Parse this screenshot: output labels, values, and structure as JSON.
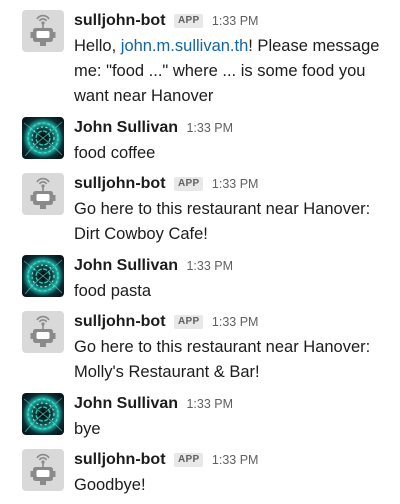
{
  "messages": [
    {
      "sender": "sulljohn-bot",
      "badge": "APP",
      "time": "1:33 PM",
      "text_before": "Hello, ",
      "link": "john.m.sullivan.th",
      "text_after": "! Please message me: \"food ...\" where ... is some food you want near Hanover",
      "avatar": "robot-icon"
    },
    {
      "sender": "John Sullivan",
      "time": "1:33 PM",
      "text": "food coffee",
      "avatar": "user-avatar"
    },
    {
      "sender": "sulljohn-bot",
      "badge": "APP",
      "time": "1:33 PM",
      "text": "Go here to this restaurant near Hanover: Dirt Cowboy Cafe!",
      "avatar": "robot-icon"
    },
    {
      "sender": "John Sullivan",
      "time": "1:33 PM",
      "text": "food pasta",
      "avatar": "user-avatar"
    },
    {
      "sender": "sulljohn-bot",
      "badge": "APP",
      "time": "1:33 PM",
      "text": "Go here to this restaurant near Hanover: Molly's Restaurant & Bar!",
      "avatar": "robot-icon"
    },
    {
      "sender": "John Sullivan",
      "time": "1:33 PM",
      "text": "bye",
      "avatar": "user-avatar"
    },
    {
      "sender": "sulljohn-bot",
      "badge": "APP",
      "time": "1:33 PM",
      "text": "Goodbye!",
      "avatar": "robot-icon"
    }
  ],
  "colors": {
    "link": "#1264a3",
    "badge_bg": "#e8e8e8",
    "timestamp": "#616061"
  }
}
